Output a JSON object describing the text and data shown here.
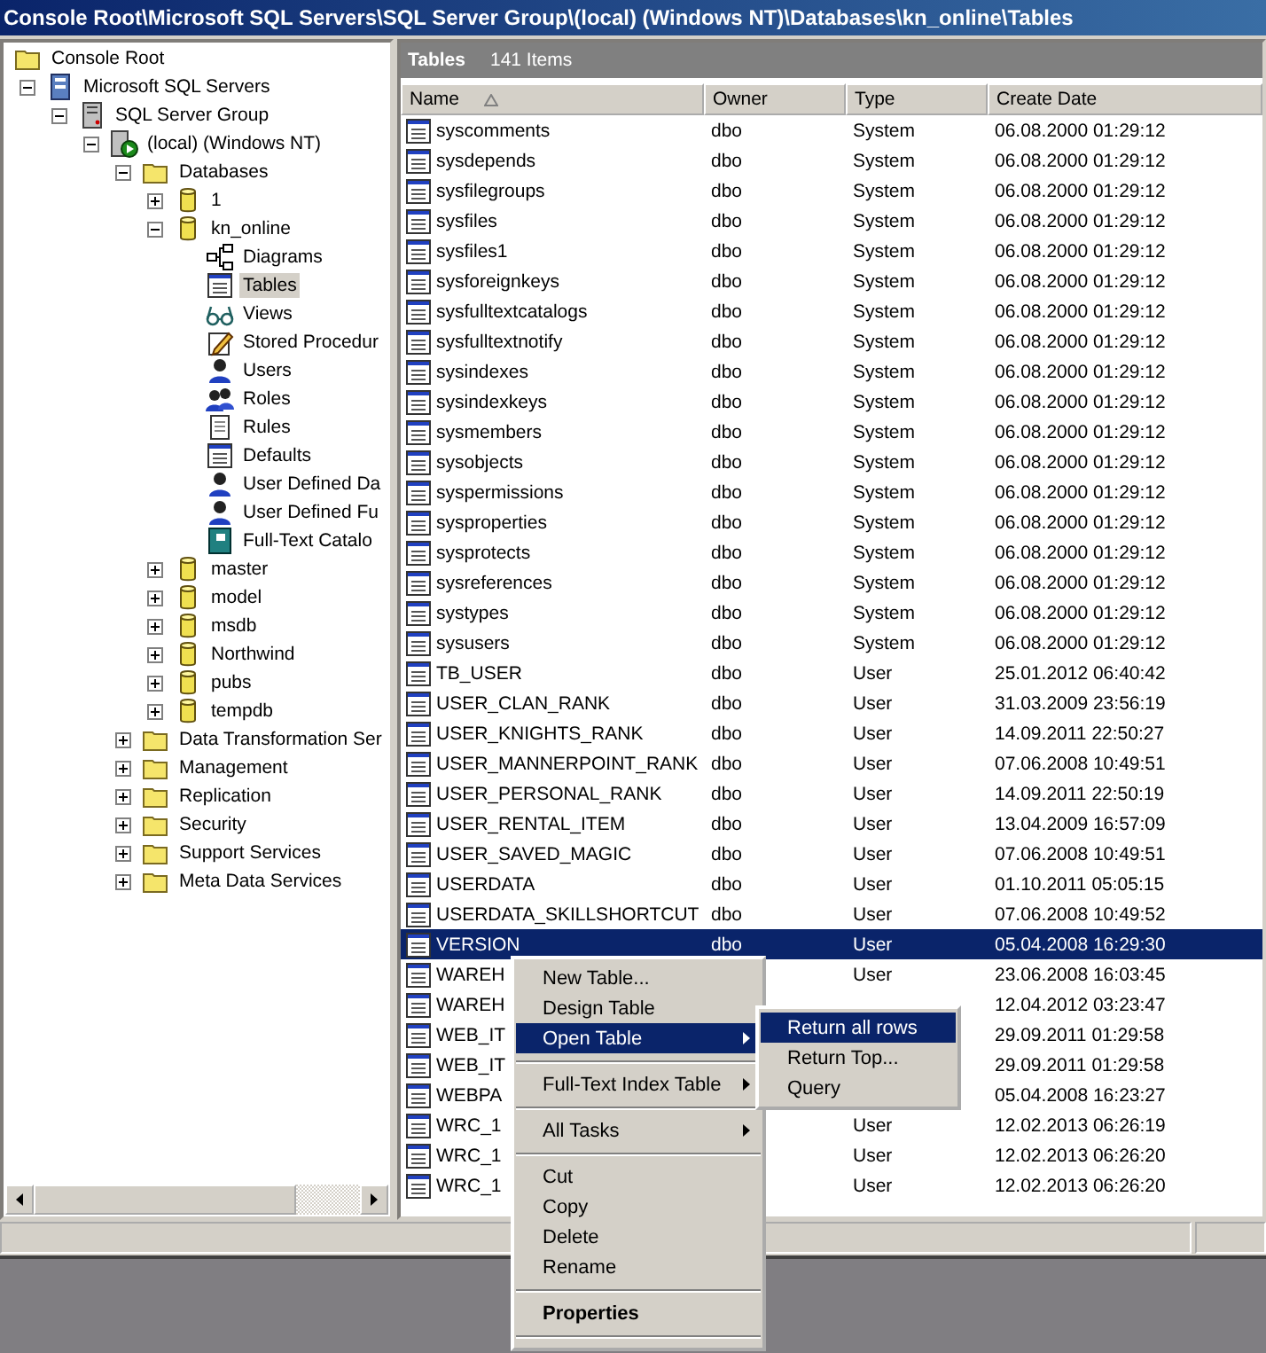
{
  "window": {
    "title": "Console Root\\Microsoft SQL Servers\\SQL Server Group\\(local) (Windows NT)\\Databases\\kn_online\\Tables"
  },
  "tree": {
    "items": [
      {
        "label": "Console Root",
        "kind": "folder",
        "selected": false,
        "children": [
          {
            "label": "Microsoft SQL Servers",
            "kind": "servers",
            "selected": false,
            "expanded": true,
            "children": [
              {
                "label": "SQL Server Group",
                "kind": "group",
                "selected": false,
                "expanded": true,
                "children": [
                  {
                    "label": "(local) (Windows NT)",
                    "kind": "server",
                    "selected": false,
                    "expanded": true,
                    "children": [
                      {
                        "label": "Databases",
                        "kind": "folder",
                        "selected": false,
                        "expanded": true,
                        "children": [
                          {
                            "label": "1",
                            "kind": "database",
                            "selected": false,
                            "expanded": false
                          },
                          {
                            "label": "kn_online",
                            "kind": "database",
                            "selected": false,
                            "expanded": true,
                            "children": [
                              {
                                "label": "Diagrams",
                                "kind": "diagram",
                                "selected": false
                              },
                              {
                                "label": "Tables",
                                "kind": "table",
                                "selected": true
                              },
                              {
                                "label": "Views",
                                "kind": "view",
                                "selected": false
                              },
                              {
                                "label": "Stored Procedur",
                                "kind": "procedure",
                                "selected": false
                              },
                              {
                                "label": "Users",
                                "kind": "person",
                                "selected": false
                              },
                              {
                                "label": "Roles",
                                "kind": "people",
                                "selected": false
                              },
                              {
                                "label": "Rules",
                                "kind": "document",
                                "selected": false
                              },
                              {
                                "label": "Defaults",
                                "kind": "table",
                                "selected": false
                              },
                              {
                                "label": "User Defined Da",
                                "kind": "person",
                                "selected": false
                              },
                              {
                                "label": "User Defined Fu",
                                "kind": "person",
                                "selected": false
                              },
                              {
                                "label": "Full-Text Catalo",
                                "kind": "book",
                                "selected": false
                              }
                            ]
                          },
                          {
                            "label": "master",
                            "kind": "database",
                            "selected": false,
                            "expanded": false
                          },
                          {
                            "label": "model",
                            "kind": "database",
                            "selected": false,
                            "expanded": false
                          },
                          {
                            "label": "msdb",
                            "kind": "database",
                            "selected": false,
                            "expanded": false
                          },
                          {
                            "label": "Northwind",
                            "kind": "database",
                            "selected": false,
                            "expanded": false
                          },
                          {
                            "label": "pubs",
                            "kind": "database",
                            "selected": false,
                            "expanded": false
                          },
                          {
                            "label": "tempdb",
                            "kind": "database",
                            "selected": false,
                            "expanded": false
                          }
                        ]
                      },
                      {
                        "label": "Data Transformation Ser",
                        "kind": "folder",
                        "selected": false,
                        "expanded": false
                      },
                      {
                        "label": "Management",
                        "kind": "folder",
                        "selected": false,
                        "expanded": false
                      },
                      {
                        "label": "Replication",
                        "kind": "folder",
                        "selected": false,
                        "expanded": false
                      },
                      {
                        "label": "Security",
                        "kind": "folder",
                        "selected": false,
                        "expanded": false
                      },
                      {
                        "label": "Support Services",
                        "kind": "folder",
                        "selected": false,
                        "expanded": false
                      },
                      {
                        "label": "Meta Data Services",
                        "kind": "folder",
                        "selected": false,
                        "expanded": false
                      }
                    ]
                  }
                ]
              }
            ]
          }
        ]
      }
    ]
  },
  "list": {
    "title": "Tables",
    "count": "141 Items",
    "columns": [
      {
        "label": "Name",
        "sorted": true
      },
      {
        "label": "Owner",
        "sorted": false
      },
      {
        "label": "Type",
        "sorted": false
      },
      {
        "label": "Create Date",
        "sorted": false
      }
    ],
    "rows": [
      {
        "name": "syscomments",
        "owner": "dbo",
        "type": "System",
        "date": "06.08.2000 01:29:12",
        "selected": false
      },
      {
        "name": "sysdepends",
        "owner": "dbo",
        "type": "System",
        "date": "06.08.2000 01:29:12",
        "selected": false
      },
      {
        "name": "sysfilegroups",
        "owner": "dbo",
        "type": "System",
        "date": "06.08.2000 01:29:12",
        "selected": false
      },
      {
        "name": "sysfiles",
        "owner": "dbo",
        "type": "System",
        "date": "06.08.2000 01:29:12",
        "selected": false
      },
      {
        "name": "sysfiles1",
        "owner": "dbo",
        "type": "System",
        "date": "06.08.2000 01:29:12",
        "selected": false
      },
      {
        "name": "sysforeignkeys",
        "owner": "dbo",
        "type": "System",
        "date": "06.08.2000 01:29:12",
        "selected": false
      },
      {
        "name": "sysfulltextcatalogs",
        "owner": "dbo",
        "type": "System",
        "date": "06.08.2000 01:29:12",
        "selected": false
      },
      {
        "name": "sysfulltextnotify",
        "owner": "dbo",
        "type": "System",
        "date": "06.08.2000 01:29:12",
        "selected": false
      },
      {
        "name": "sysindexes",
        "owner": "dbo",
        "type": "System",
        "date": "06.08.2000 01:29:12",
        "selected": false
      },
      {
        "name": "sysindexkeys",
        "owner": "dbo",
        "type": "System",
        "date": "06.08.2000 01:29:12",
        "selected": false
      },
      {
        "name": "sysmembers",
        "owner": "dbo",
        "type": "System",
        "date": "06.08.2000 01:29:12",
        "selected": false
      },
      {
        "name": "sysobjects",
        "owner": "dbo",
        "type": "System",
        "date": "06.08.2000 01:29:12",
        "selected": false
      },
      {
        "name": "syspermissions",
        "owner": "dbo",
        "type": "System",
        "date": "06.08.2000 01:29:12",
        "selected": false
      },
      {
        "name": "sysproperties",
        "owner": "dbo",
        "type": "System",
        "date": "06.08.2000 01:29:12",
        "selected": false
      },
      {
        "name": "sysprotects",
        "owner": "dbo",
        "type": "System",
        "date": "06.08.2000 01:29:12",
        "selected": false
      },
      {
        "name": "sysreferences",
        "owner": "dbo",
        "type": "System",
        "date": "06.08.2000 01:29:12",
        "selected": false
      },
      {
        "name": "systypes",
        "owner": "dbo",
        "type": "System",
        "date": "06.08.2000 01:29:12",
        "selected": false
      },
      {
        "name": "sysusers",
        "owner": "dbo",
        "type": "System",
        "date": "06.08.2000 01:29:12",
        "selected": false
      },
      {
        "name": "TB_USER",
        "owner": "dbo",
        "type": "User",
        "date": "25.01.2012 06:40:42",
        "selected": false
      },
      {
        "name": "USER_CLAN_RANK",
        "owner": "dbo",
        "type": "User",
        "date": "31.03.2009 23:56:19",
        "selected": false
      },
      {
        "name": "USER_KNIGHTS_RANK",
        "owner": "dbo",
        "type": "User",
        "date": "14.09.2011 22:50:27",
        "selected": false
      },
      {
        "name": "USER_MANNERPOINT_RANK",
        "owner": "dbo",
        "type": "User",
        "date": "07.06.2008 10:49:51",
        "selected": false
      },
      {
        "name": "USER_PERSONAL_RANK",
        "owner": "dbo",
        "type": "User",
        "date": "14.09.2011 22:50:19",
        "selected": false
      },
      {
        "name": "USER_RENTAL_ITEM",
        "owner": "dbo",
        "type": "User",
        "date": "13.04.2009 16:57:09",
        "selected": false
      },
      {
        "name": "USER_SAVED_MAGIC",
        "owner": "dbo",
        "type": "User",
        "date": "07.06.2008 10:49:51",
        "selected": false
      },
      {
        "name": "USERDATA",
        "owner": "dbo",
        "type": "User",
        "date": "01.10.2011 05:05:15",
        "selected": false
      },
      {
        "name": "USERDATA_SKILLSHORTCUT",
        "owner": "dbo",
        "type": "User",
        "date": "07.06.2008 10:49:52",
        "selected": false
      },
      {
        "name": "VERSION",
        "owner": "dbo",
        "type": "User",
        "date": "05.04.2008 16:29:30",
        "selected": true
      },
      {
        "name": "WAREH",
        "type": "User",
        "date": "23.06.2008 16:03:45",
        "selected": false
      },
      {
        "name": "WAREH",
        "date": "12.04.2012 03:23:47",
        "selected": false
      },
      {
        "name": "WEB_IT",
        "date": "29.09.2011 01:29:58",
        "selected": false
      },
      {
        "name": "WEB_IT",
        "date": "29.09.2011 01:29:58",
        "selected": false
      },
      {
        "name": "WEBPA",
        "date": "05.04.2008 16:23:27",
        "selected": false
      },
      {
        "name": "WRC_1",
        "type": "User",
        "date": "12.02.2013 06:26:19",
        "selected": false
      },
      {
        "name": "WRC_1",
        "type": "User",
        "date": "12.02.2013 06:26:20",
        "selected": false
      },
      {
        "name": "WRC_1",
        "type": "User",
        "date": "12.02.2013 06:26:20",
        "selected": false
      }
    ]
  },
  "context_menu": {
    "items": [
      {
        "kind": "item",
        "label": "New Table...",
        "selected": false
      },
      {
        "kind": "item",
        "label": "Design Table",
        "selected": false
      },
      {
        "kind": "item",
        "label": "Open Table",
        "selected": true,
        "submenu": true
      },
      {
        "kind": "separator"
      },
      {
        "kind": "item",
        "label": "Full-Text Index Table",
        "selected": false,
        "submenu": true
      },
      {
        "kind": "separator"
      },
      {
        "kind": "item",
        "label": "All Tasks",
        "selected": false,
        "submenu": true
      },
      {
        "kind": "separator"
      },
      {
        "kind": "item",
        "label": "Cut",
        "selected": false
      },
      {
        "kind": "item",
        "label": "Copy",
        "selected": false
      },
      {
        "kind": "item",
        "label": "Delete",
        "selected": false
      },
      {
        "kind": "item",
        "label": "Rename",
        "selected": false
      },
      {
        "kind": "separator"
      },
      {
        "kind": "item",
        "label": "Properties",
        "selected": false,
        "default": true
      },
      {
        "kind": "separator"
      }
    ]
  },
  "submenu": {
    "items": [
      {
        "kind": "item",
        "label": "Return all rows",
        "selected": true
      },
      {
        "kind": "item",
        "label": "Return Top...",
        "selected": false
      },
      {
        "kind": "item",
        "label": "Query",
        "selected": false
      }
    ]
  }
}
